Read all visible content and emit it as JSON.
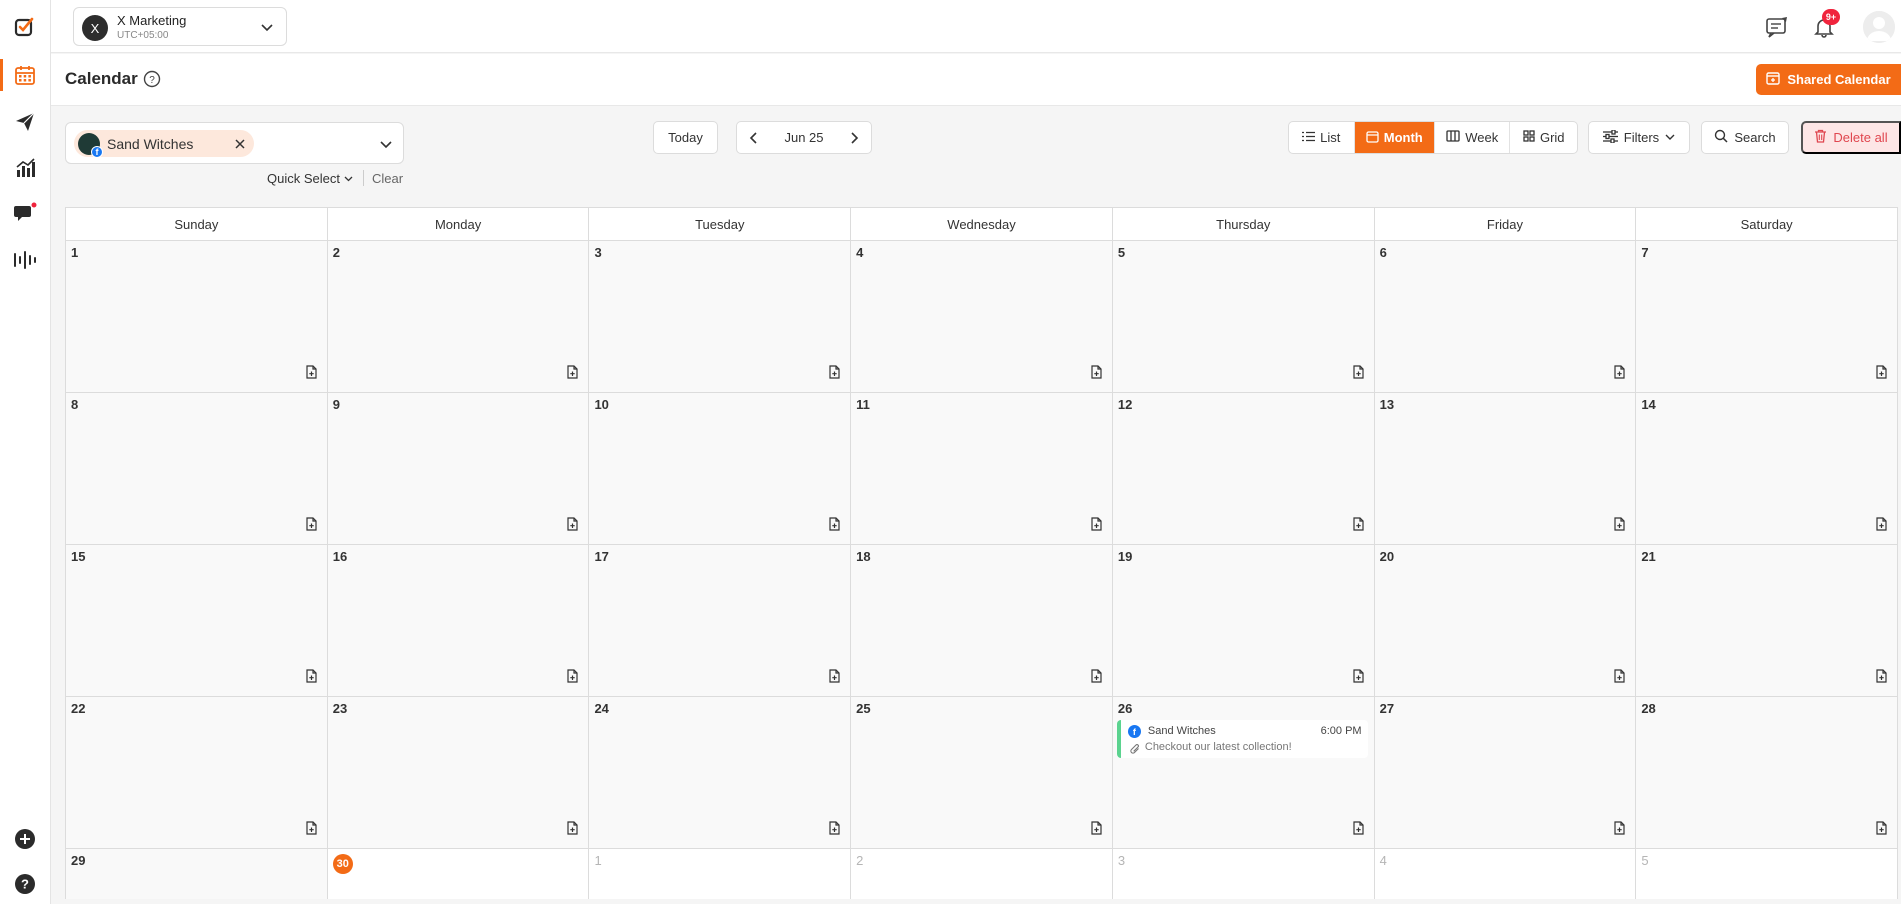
{
  "workspace": {
    "initial": "X",
    "name": "X Marketing",
    "timezone": "UTC+05:00"
  },
  "notifications": {
    "badge": "9+"
  },
  "page": {
    "title": "Calendar",
    "shared_calendar_label": "Shared Calendar"
  },
  "account_filter": {
    "selected": "Sand Witches",
    "quick_select_label": "Quick Select",
    "clear_label": "Clear"
  },
  "date_nav": {
    "today_label": "Today",
    "current": "Jun 25"
  },
  "views": {
    "list": "List",
    "month": "Month",
    "week": "Week",
    "grid": "Grid",
    "active": "Month"
  },
  "filters_label": "Filters",
  "search_label": "Search",
  "delete_all_label": "Delete all",
  "calendar": {
    "weekdays": [
      "Sunday",
      "Monday",
      "Tuesday",
      "Wednesday",
      "Thursday",
      "Friday",
      "Saturday"
    ],
    "weeks": [
      [
        "1",
        "2",
        "3",
        "4",
        "5",
        "6",
        "7"
      ],
      [
        "8",
        "9",
        "10",
        "11",
        "12",
        "13",
        "14"
      ],
      [
        "15",
        "16",
        "17",
        "18",
        "19",
        "20",
        "21"
      ],
      [
        "22",
        "23",
        "24",
        "25",
        "26",
        "27",
        "28"
      ],
      [
        "29",
        "30",
        "1",
        "2",
        "3",
        "4",
        "5"
      ]
    ],
    "today": "30",
    "event": {
      "day": "26",
      "account": "Sand Witches",
      "time": "6:00 PM",
      "caption": "Checkout our latest collection!",
      "platform_icon": "facebook-icon",
      "status_color": "#5bd38f"
    }
  },
  "colors": {
    "accent": "#f36b16",
    "danger": "#e0464f",
    "badge": "#f0243d"
  }
}
